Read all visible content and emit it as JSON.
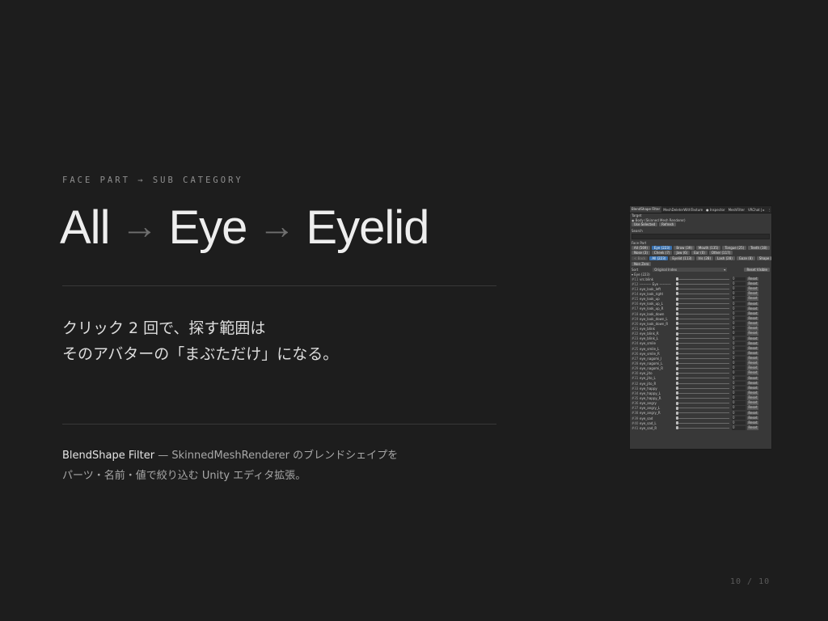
{
  "slide": {
    "eyebrow": "FACE PART → SUB CATEGORY",
    "headline": [
      "All",
      "Eye",
      "Eyelid"
    ],
    "headline_arrow": "→",
    "body_lines": [
      "クリック 2 回で、探す範囲は",
      "そのアバターの「まぶただけ」になる。"
    ],
    "caption_strong": "BlendShape Filter",
    "caption_rest": " — SkinnedMeshRenderer のブレンドシェイプを",
    "caption_line2": "パーツ・名前・値で絞り込む Unity エディタ拡張。",
    "page": "10 / 10"
  },
  "inspector": {
    "tabs": [
      "BlendShape Filter",
      "MeshDeleterWithTexture",
      "● Inspector",
      "MeshFilter",
      "VRChat | ▸"
    ],
    "tabs_ellipsis": "⋮",
    "target_label": "Target",
    "target_value": "◉ Body (Skinned Mesh Renderer)",
    "use_selected": "Use Selected",
    "refresh": "Refresh",
    "search_label": "Search",
    "face_part_label": "Face Part",
    "part_rows": [
      [
        {
          "label": "All (569)",
          "sel": false
        },
        {
          "label": "Eye (223)",
          "sel": true
        },
        {
          "label": "Brow (39)",
          "sel": false
        },
        {
          "label": "Mouth (135)",
          "sel": false
        },
        {
          "label": "Tongue (25)",
          "sel": false
        },
        {
          "label": "Teeth (18)",
          "sel": false
        }
      ],
      [
        {
          "label": "Nose (3)",
          "sel": false
        },
        {
          "label": "Cheek (7)",
          "sel": false
        },
        {
          "label": "Jaw (6)",
          "sel": false
        },
        {
          "label": "Ear (0)",
          "sel": false
        },
        {
          "label": "Other (117)",
          "sel": false
        }
      ]
    ],
    "sub_rows": [
      [
        {
          "label": "< Back",
          "sel": false,
          "dim": true
        },
        {
          "label": "All (223)",
          "sel": true
        },
        {
          "label": "Eyelid (113)",
          "sel": false
        },
        {
          "label": "Iris (28)",
          "sel": false
        },
        {
          "label": "Lash (28)",
          "sel": false
        },
        {
          "label": "Gaze (8)",
          "sel": false
        },
        {
          "label": "Shape (52)",
          "sel": false
        }
      ]
    ],
    "non_zero": "Non Zero",
    "sort_label": "Sort",
    "sort_value": "Original Index",
    "sort_dd": "▾",
    "reset_visible": "Reset Visible",
    "group_title": "▾ Eye (223)",
    "reset_label": "Reset",
    "shapes": [
      {
        "i": "#11",
        "n": "vrc.blink",
        "v": "0"
      },
      {
        "i": "#12",
        "n": "---------- Eye ----------",
        "v": "0"
      },
      {
        "i": "#13",
        "n": "eye_look_left",
        "v": "0"
      },
      {
        "i": "#14",
        "n": "eye_look_right",
        "v": "0"
      },
      {
        "i": "#15",
        "n": "eye_look_up",
        "v": "0"
      },
      {
        "i": "#16",
        "n": "eye_look_up_L",
        "v": "0"
      },
      {
        "i": "#17",
        "n": "eye_look_up_R",
        "v": "0"
      },
      {
        "i": "#18",
        "n": "eye_look_down",
        "v": "0"
      },
      {
        "i": "#19",
        "n": "eye_look_down_L",
        "v": "0"
      },
      {
        "i": "#20",
        "n": "eye_look_down_R",
        "v": "0"
      },
      {
        "i": "#21",
        "n": "eye_blink",
        "v": "0"
      },
      {
        "i": "#22",
        "n": "eye_blink_R",
        "v": "0"
      },
      {
        "i": "#23",
        "n": "eye_blink_L",
        "v": "0"
      },
      {
        "i": "#24",
        "n": "eye_smile",
        "v": "0"
      },
      {
        "i": "#25",
        "n": "eye_smile_L",
        "v": "0"
      },
      {
        "i": "#26",
        "n": "eye_smile_R",
        "v": "0"
      },
      {
        "i": "#27",
        "n": "eye_nagomi_l",
        "v": "0"
      },
      {
        "i": "#28",
        "n": "eye_nagomi_L",
        "v": "0"
      },
      {
        "i": "#29",
        "n": "eye_nagomi_R",
        "v": "0"
      },
      {
        "i": "#30",
        "n": "eye_jito",
        "v": "0"
      },
      {
        "i": "#31",
        "n": "eye_jito_L",
        "v": "0"
      },
      {
        "i": "#32",
        "n": "eye_jito_R",
        "v": "0"
      },
      {
        "i": "#33",
        "n": "eye_happy",
        "v": "0"
      },
      {
        "i": "#34",
        "n": "eye_happy_L",
        "v": "0"
      },
      {
        "i": "#35",
        "n": "eye_happy_R",
        "v": "0"
      },
      {
        "i": "#36",
        "n": "eye_angry",
        "v": "0"
      },
      {
        "i": "#37",
        "n": "eye_angry_L",
        "v": "0"
      },
      {
        "i": "#38",
        "n": "eye_angry_R",
        "v": "0"
      },
      {
        "i": "#39",
        "n": "eye_sad",
        "v": "0"
      },
      {
        "i": "#40",
        "n": "eye_sad_L",
        "v": "0"
      },
      {
        "i": "#41",
        "n": "eye_sad_R",
        "v": "0"
      }
    ]
  }
}
